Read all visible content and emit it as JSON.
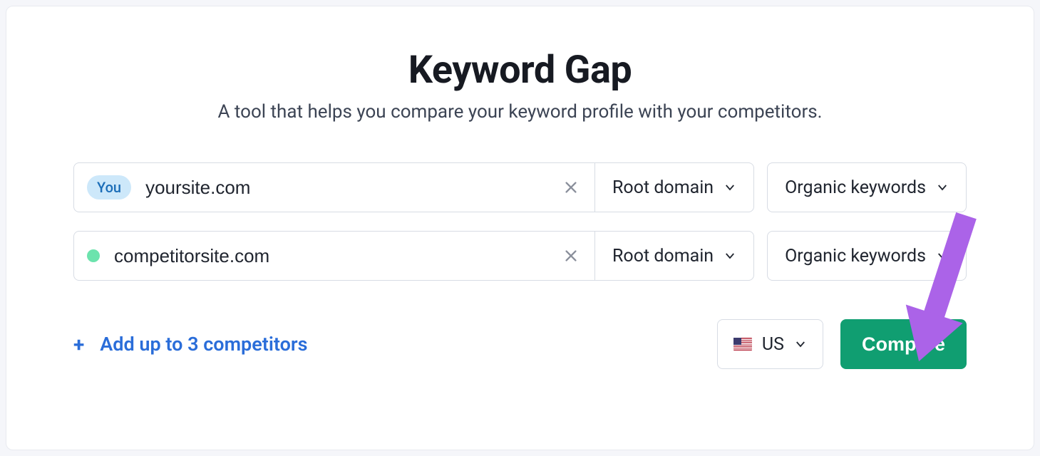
{
  "header": {
    "title": "Keyword Gap",
    "subtitle": "A tool that helps you compare your keyword profile with your competitors."
  },
  "rows": [
    {
      "tag": "You",
      "domain": "yoursite.com",
      "scope": "Root domain",
      "keywords": "Organic keywords"
    },
    {
      "domain": "competitorsite.com",
      "scope": "Root domain",
      "keywords": "Organic keywords"
    }
  ],
  "add_link": "Add up to 3 competitors",
  "country": {
    "code": "US"
  },
  "compare_label": "Compare"
}
